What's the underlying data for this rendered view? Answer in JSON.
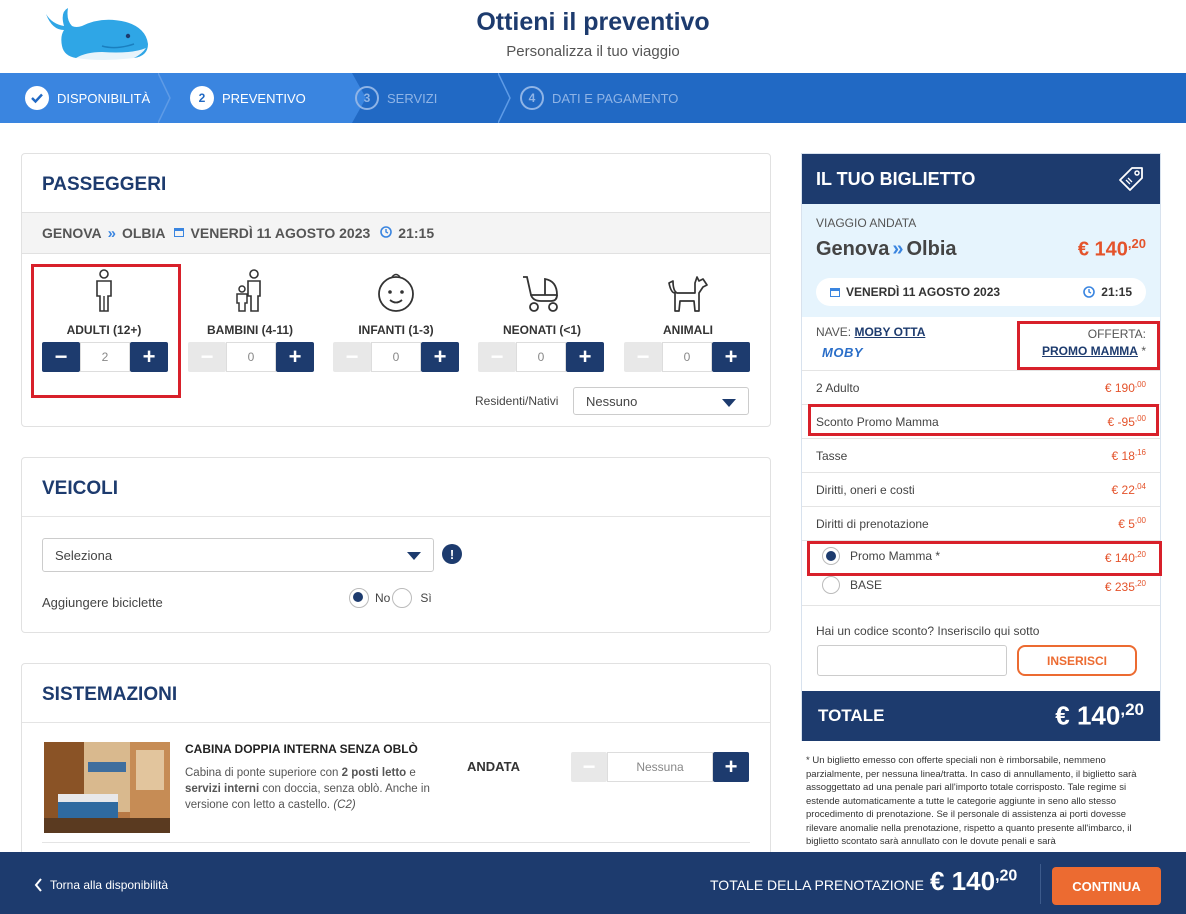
{
  "header": {
    "title": "Ottieni il preventivo",
    "subtitle": "Personalizza il tuo viaggio"
  },
  "steps": [
    {
      "num": "1",
      "label": "Disponibilità",
      "state": "done"
    },
    {
      "num": "2",
      "label": "Preventivo",
      "state": "active"
    },
    {
      "num": "3",
      "label": "Servizi",
      "state": "inactive"
    },
    {
      "num": "4",
      "label": "Dati e pagamento",
      "state": "inactive"
    }
  ],
  "passengers": {
    "title": "Passeggeri",
    "route": {
      "from": "GENOVA",
      "to": "OLBIA",
      "date": "VENERDÌ 11 AGOSTO 2023",
      "time": "21:15"
    },
    "types": [
      {
        "label": "ADULTI (12+)",
        "value": "2"
      },
      {
        "label": "BAMBINI (4-11)",
        "value": "0"
      },
      {
        "label": "INFANTI (1-3)",
        "value": "0"
      },
      {
        "label": "NEONATI (<1)",
        "value": "0"
      },
      {
        "label": "ANIMALI",
        "value": "0"
      }
    ],
    "residents_label": "Residenti/Nativi",
    "residents_value": "Nessuno"
  },
  "vehicles": {
    "title": "Veicoli",
    "select_value": "Seleziona",
    "info": "!",
    "bikes_label": "Aggiungere biciclette",
    "no": "No",
    "yes": "Sì"
  },
  "accommodations": {
    "title": "Sistemazioni",
    "cabin_title": "CABINA DOPPIA INTERNA SENZA OBLÒ",
    "desc_1": "Cabina di ponte superiore con ",
    "desc_b1": "2 posti letto",
    "desc_2": " e ",
    "desc_b2": "servizi interni",
    "desc_3": " con doccia, senza oblò. Anche in versione con letto a castello. ",
    "desc_code": "(C2)",
    "direction": "ANDATA",
    "value": "Nessuna"
  },
  "ticket": {
    "title": "Il tuo biglietto",
    "trip_label": "VIAGGIO ANDATA",
    "from": "Genova",
    "to": "Olbia",
    "price_int": "€ 140",
    "price_dec": ",20",
    "date": "VENERDÌ 11 AGOSTO 2023",
    "time": "21:15",
    "ship_label": "NAVE:",
    "ship_name": "MOBY OTTA",
    "ship_logo": "MOBY",
    "offer_label": "OFFERTA:",
    "offer_name": "PROMO MAMMA",
    "offer_star": " *",
    "lines": [
      {
        "label": "2 Adulto",
        "int": "€ 190",
        "dec": ",00"
      },
      {
        "label": "Sconto Promo Mamma",
        "int": "€ -95",
        "dec": ",00"
      },
      {
        "label": "Tasse",
        "int": "€ 18",
        "dec": ",16"
      },
      {
        "label": "Diritti, oneri e costi",
        "int": "€ 22",
        "dec": ",04"
      },
      {
        "label": "Diritti di prenotazione",
        "int": "€ 5",
        "dec": ",00"
      }
    ],
    "fares": [
      {
        "label": "Promo Mamma *",
        "int": "€ 140",
        "dec": ",20",
        "selected": true
      },
      {
        "label": "BASE",
        "int": "€ 235",
        "dec": ",20",
        "selected": false
      }
    ],
    "discount_label": "Hai un codice sconto? Inseriscilo qui sotto",
    "discount_button": "Inserisci",
    "total_label": "TOTALE",
    "total_int": "€ 140",
    "total_dec": ",20"
  },
  "note": "* Un biglietto emesso con offerte speciali non è rimborsabile, nemmeno parzialmente, per nessuna linea/tratta. In caso di annullamento, il biglietto sarà assoggettato ad una penale pari all'importo totale corrisposto. Tale regime si estende automaticamente a tutte le categorie aggiunte in seno allo stesso procedimento di prenotazione. Se il personale di assistenza ai porti dovesse rilevare anomalie nella prenotazione, rispetto a quanto presente all'imbarco, il biglietto scontato sarà annullato con le dovute penali e sarà",
  "bottom": {
    "back": "Torna alla disponibilità",
    "total_label": "TOTALE DELLA PRENOTAZIONE",
    "total_int": "€ 140",
    "total_dec": ",20",
    "continue": "Continua"
  },
  "colors": {
    "navy": "#1d3b6e",
    "blue": "#2169c4",
    "orange": "#ec6b31",
    "red_highlight": "#d8202a",
    "ticket_light": "#e6f4fd"
  }
}
